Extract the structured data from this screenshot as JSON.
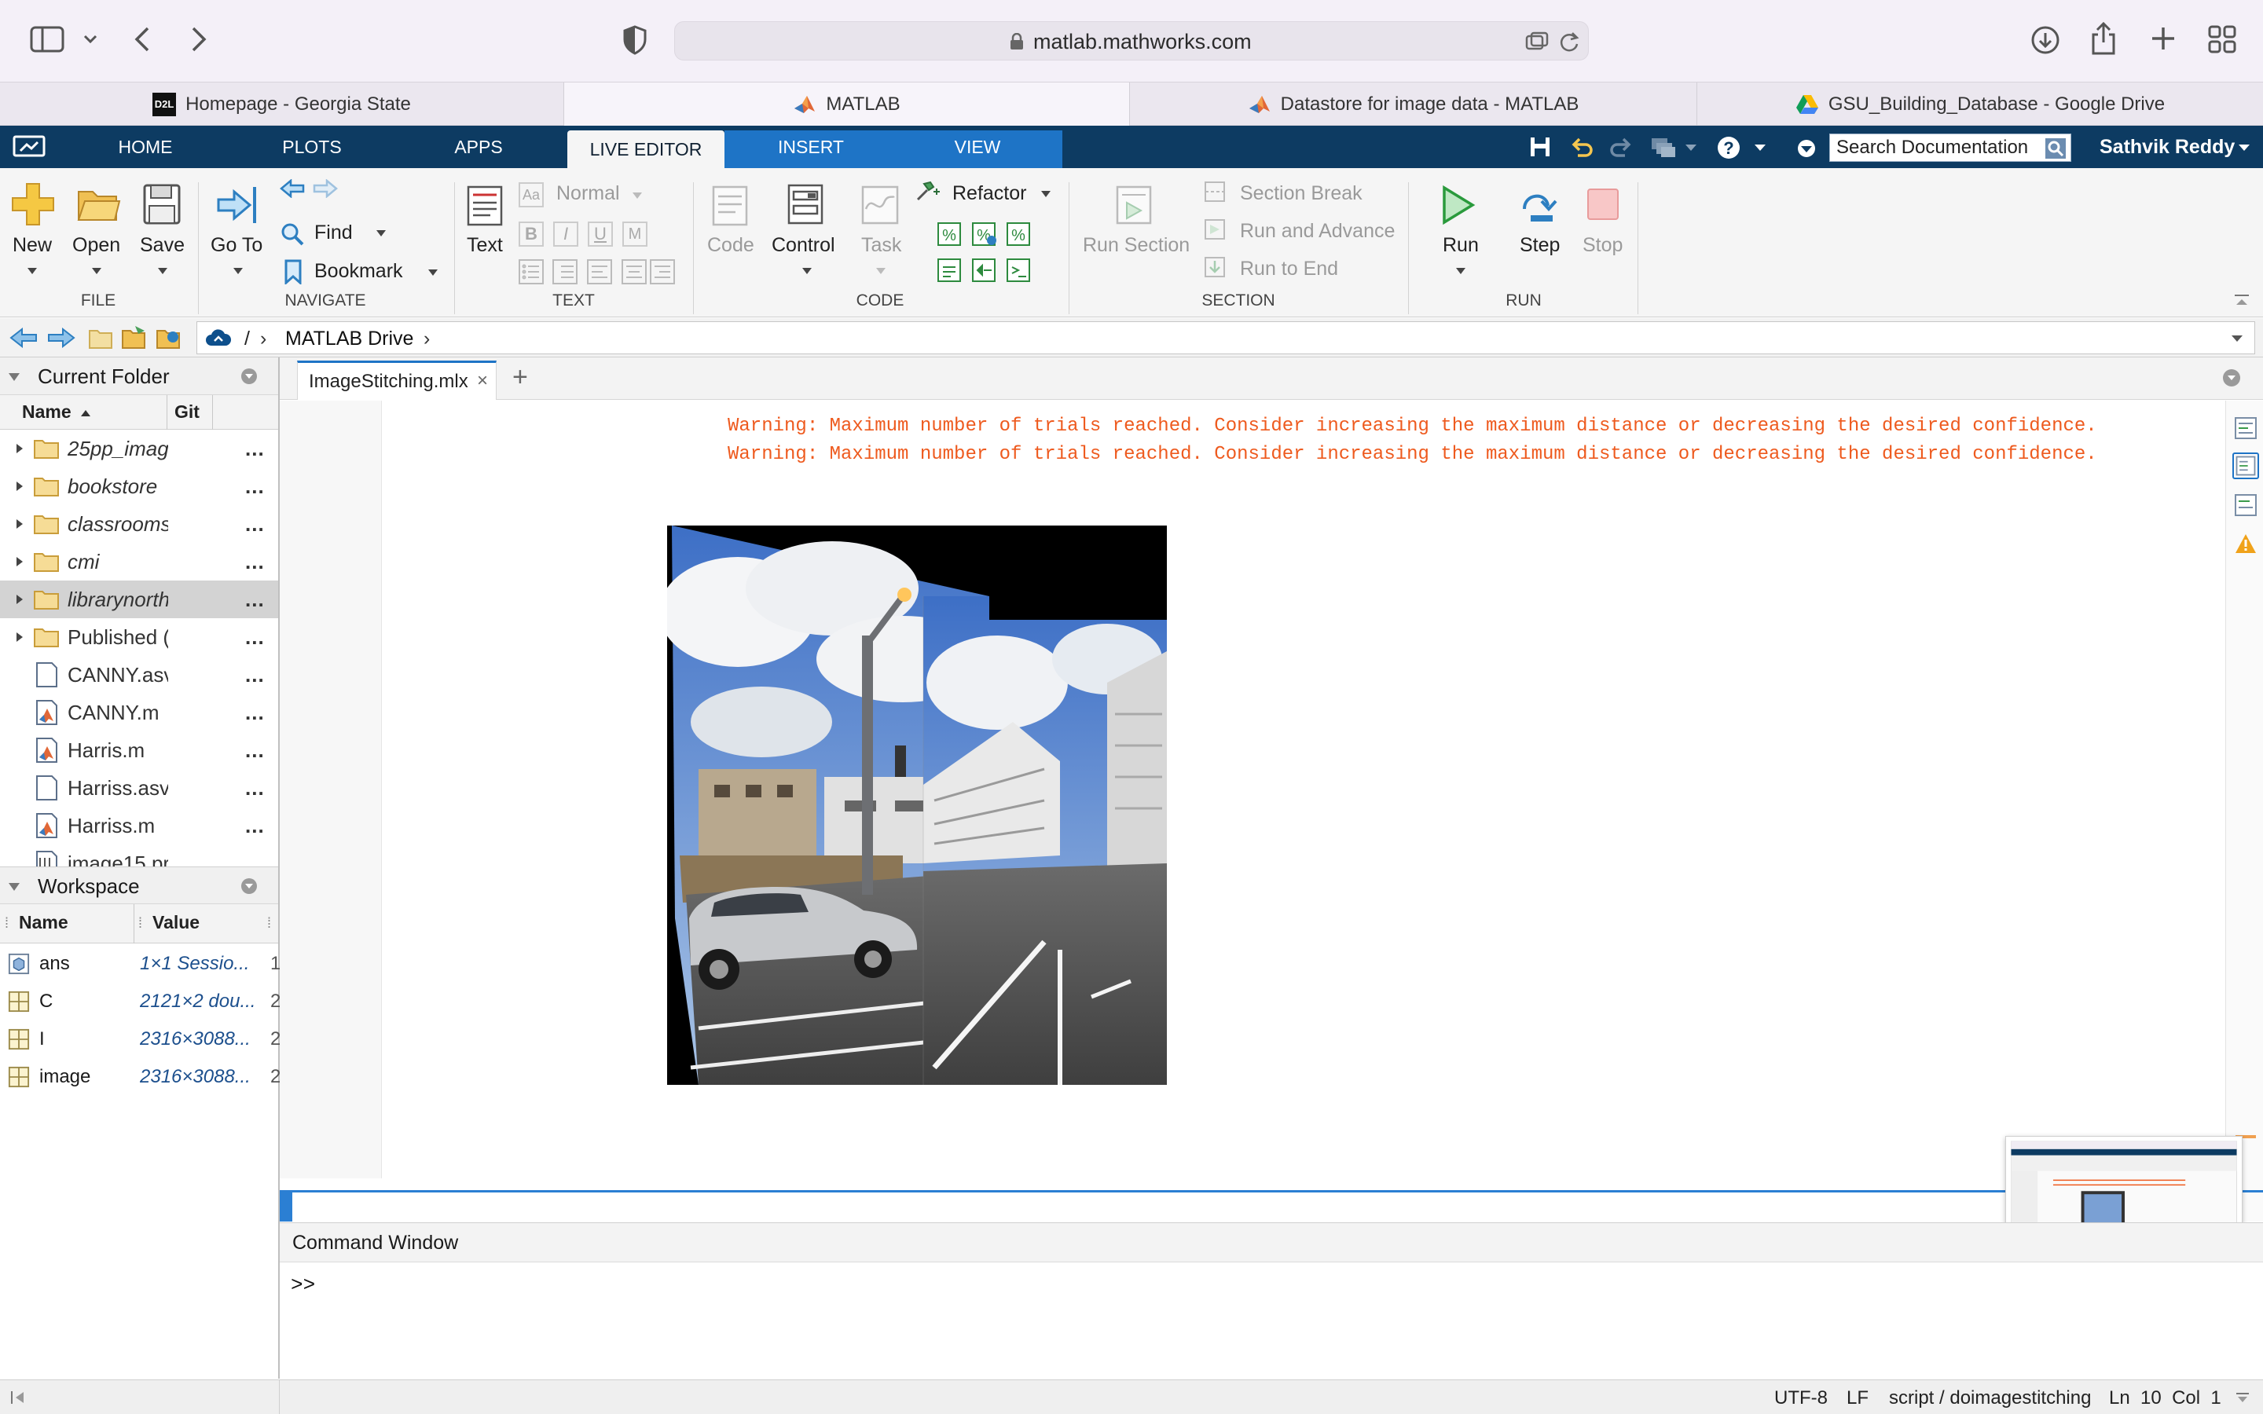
{
  "browser": {
    "url": "matlab.mathworks.com",
    "tabs": [
      {
        "title": "Homepage - Georgia State",
        "favicon": "d2l-favicon"
      },
      {
        "title": "MATLAB",
        "favicon": "matlab-favicon",
        "active": true
      },
      {
        "title": "Datastore for image data - MATLAB",
        "favicon": "matlab-favicon"
      },
      {
        "title": "GSU_Building_Database - Google Drive",
        "favicon": "google-drive-favicon"
      }
    ],
    "d2l_badge": "D2L"
  },
  "ribbon": {
    "tabs": [
      "HOME",
      "PLOTS",
      "APPS",
      "LIVE EDITOR",
      "INSERT",
      "VIEW"
    ],
    "active_tab": "LIVE EDITOR",
    "search_placeholder": "Search Documentation",
    "user": "Sathvik Reddy",
    "file": {
      "group": "FILE",
      "new": "New",
      "open": "Open",
      "save": "Save"
    },
    "navigate": {
      "group": "NAVIGATE",
      "goto": "Go To",
      "find": "Find",
      "bookmark": "Bookmark"
    },
    "text": {
      "group": "TEXT",
      "text": "Text",
      "style": "Normal",
      "format_letters": [
        "B",
        "I",
        "U",
        "M"
      ],
      "aa": "Aa"
    },
    "code": {
      "group": "CODE",
      "code": "Code",
      "control": "Control",
      "task": "Task",
      "refactor": "Refactor"
    },
    "section": {
      "group": "SECTION",
      "run_section": "Run Section",
      "section_break": "Section Break",
      "run_and_advance": "Run and Advance",
      "run_to_end": "Run to End"
    },
    "run": {
      "group": "RUN",
      "run": "Run",
      "step": "Step",
      "stop": "Stop"
    }
  },
  "path": {
    "root": "/",
    "folder": "MATLAB Drive"
  },
  "current_folder": {
    "title": "Current Folder",
    "col_name": "Name",
    "col_git": "Git",
    "items": [
      {
        "name": "25pp_imag",
        "type": "folder",
        "italic": true
      },
      {
        "name": "bookstore",
        "type": "folder",
        "italic": true
      },
      {
        "name": "classrooms",
        "type": "folder",
        "italic": true
      },
      {
        "name": "cmi",
        "type": "folder",
        "italic": true
      },
      {
        "name": "librarynorth",
        "type": "folder",
        "italic": true,
        "selected": true
      },
      {
        "name": "Published (",
        "type": "folder",
        "italic": false
      },
      {
        "name": "CANNY.asv",
        "type": "file",
        "italic": false
      },
      {
        "name": "CANNY.m",
        "type": "mfile",
        "italic": false
      },
      {
        "name": "Harris.m",
        "type": "mfile",
        "italic": false
      },
      {
        "name": "Harriss.asv",
        "type": "file",
        "italic": false
      },
      {
        "name": "Harriss.m",
        "type": "mfile",
        "italic": false
      },
      {
        "name": "image15.pr",
        "type": "image",
        "italic": false
      }
    ],
    "more": "..."
  },
  "workspace": {
    "title": "Workspace",
    "col_name": "Name",
    "col_value": "Value",
    "vars": [
      {
        "name": "ans",
        "value": "1×1 Sessio...",
        "extra": "1",
        "icon": "object-icon"
      },
      {
        "name": "C",
        "value": "2121×2 dou...",
        "extra": "2",
        "icon": "matrix-icon"
      },
      {
        "name": "I",
        "value": "2316×3088...",
        "extra": "2",
        "icon": "matrix-icon"
      },
      {
        "name": "image",
        "value": "2316×3088...",
        "extra": "2",
        "icon": "matrix-icon"
      }
    ]
  },
  "editor": {
    "tab": "ImageStitching.mlx",
    "close": "×",
    "add": "+",
    "warnings": [
      "Warning: Maximum number of trials reached. Consider increasing the maximum distance or decreasing the desired confidence.",
      "Warning: Maximum number of trials reached. Consider increasing the maximum distance or decreasing the desired confidence."
    ],
    "output_figure": "stitched panorama of a street intersection with a parked silver car and buildings"
  },
  "command_window": {
    "title": "Command Window",
    "prompt": ">>"
  },
  "status": {
    "encoding": "UTF-8",
    "eol": "LF",
    "script": "script / doimagestitching",
    "position": "Ln  10  Col  1"
  },
  "colors": {
    "matlab_blue": "#0d3b62",
    "tab_blue": "#1e74c6",
    "warning": "#ee5a1e",
    "link_blue": "#1c4f8d"
  }
}
